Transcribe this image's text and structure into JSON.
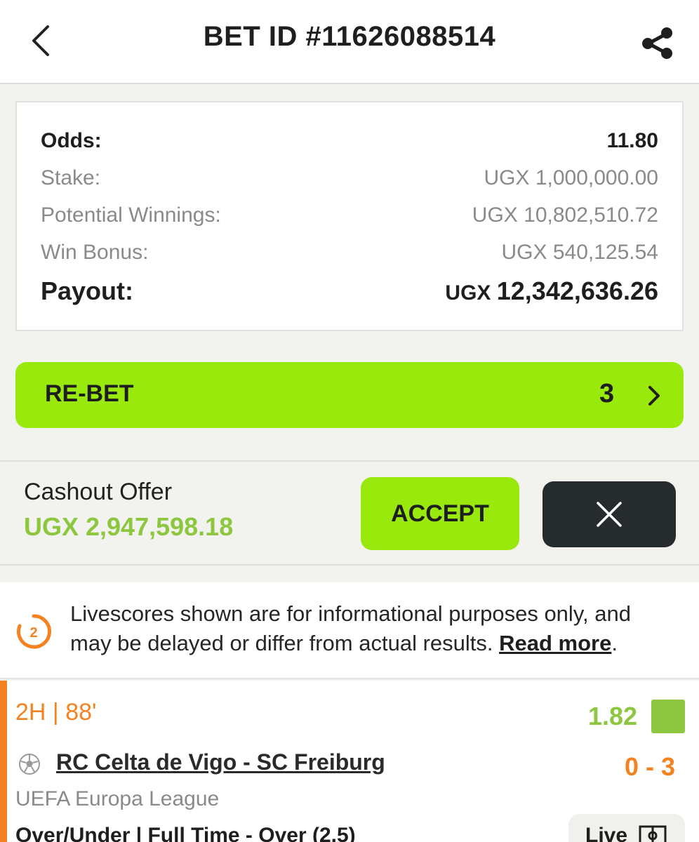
{
  "header": {
    "title": "BET ID #11626088514"
  },
  "summary": {
    "odds_label": "Odds:",
    "odds_value": "11.80",
    "stake_label": "Stake:",
    "stake_value": "UGX 1,000,000.00",
    "potential_label": "Potential Winnings:",
    "potential_value": "UGX 10,802,510.72",
    "bonus_label": "Win Bonus:",
    "bonus_value": "UGX 540,125.54",
    "payout_label": "Payout:",
    "payout_currency": "UGX",
    "payout_amount": "12,342,636.26"
  },
  "rebet": {
    "label": "RE-BET",
    "count": "3"
  },
  "cashout": {
    "title": "Cashout Offer",
    "amount": "UGX 2,947,598.18",
    "accept_label": "ACCEPT"
  },
  "notice": {
    "badge": "2",
    "text": "Livescores shown are for informational purposes only, and may be delayed or differ from actual results. ",
    "read_more": "Read more",
    "period": "."
  },
  "match": {
    "time": "2H | 88'",
    "odds": "1.82",
    "name": "RC Celta de Vigo - SC Freiburg",
    "score": "0 - 3",
    "league": "UEFA Europa League",
    "market": "Over/Under | Full Time - Over (2.5)",
    "live_label": "Live"
  },
  "colors": {
    "accent_green": "#9ae90d",
    "win_green": "#8dc63f",
    "live_orange": "#f58220",
    "dark_button": "#262b2e"
  },
  "icons": [
    "back-chevron-icon",
    "share-icon",
    "chevron-right-icon",
    "close-icon",
    "countdown-icon",
    "soccer-ball-icon",
    "pitch-icon"
  ]
}
